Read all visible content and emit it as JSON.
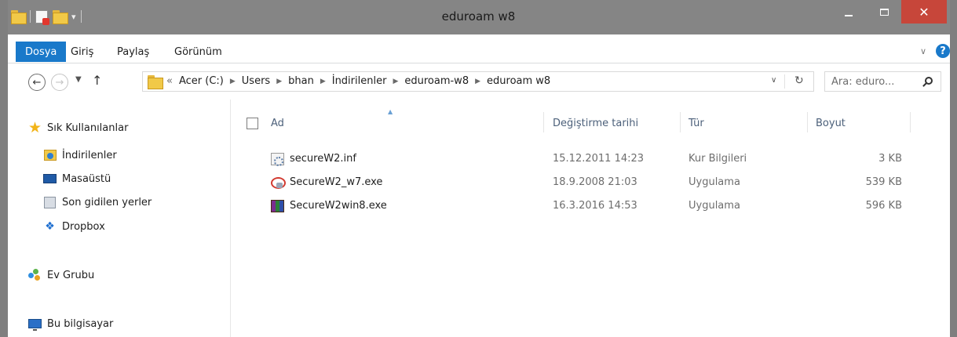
{
  "window": {
    "title": "eduroam w8",
    "close_glyph": "✕"
  },
  "ribbon": {
    "tabs": [
      "Dosya",
      "Giriş",
      "Paylaş",
      "Görünüm"
    ],
    "help_glyph": "?"
  },
  "address_bar": {
    "lead": "«",
    "crumbs": [
      "Acer (C:)",
      "Users",
      "bhan",
      "İndirilenler",
      "eduroam-w8",
      "eduroam w8"
    ]
  },
  "search": {
    "placeholder": "Ara: eduro..."
  },
  "nav_pane": {
    "favorites_label": "Sık Kullanılanlar",
    "favorites": [
      "İndirilenler",
      "Masaüstü",
      "Son gidilen yerler",
      "Dropbox"
    ],
    "homegroup": "Ev Grubu",
    "this_pc": "Bu bilgisayar"
  },
  "columns": {
    "name": "Ad",
    "date": "Değiştirme tarihi",
    "type": "Tür",
    "size": "Boyut"
  },
  "files": [
    {
      "name": "secureW2.inf",
      "date": "15.12.2011 14:23",
      "type": "Kur Bilgileri",
      "size": "3 KB",
      "icon": "setup-info-icon"
    },
    {
      "name": "SecureW2_w7.exe",
      "date": "18.9.2008 21:03",
      "type": "Uygulama",
      "size": "539 KB",
      "icon": "securew2-app-icon"
    },
    {
      "name": "SecureW2win8.exe",
      "date": "16.3.2016 14:53",
      "type": "Uygulama",
      "size": "596 KB",
      "icon": "winrar-sfx-icon"
    }
  ],
  "colors": {
    "titlebar": "#858585",
    "file_tab": "#1979ca",
    "close_button": "#c7463a",
    "column_header_text": "#4c607a"
  }
}
